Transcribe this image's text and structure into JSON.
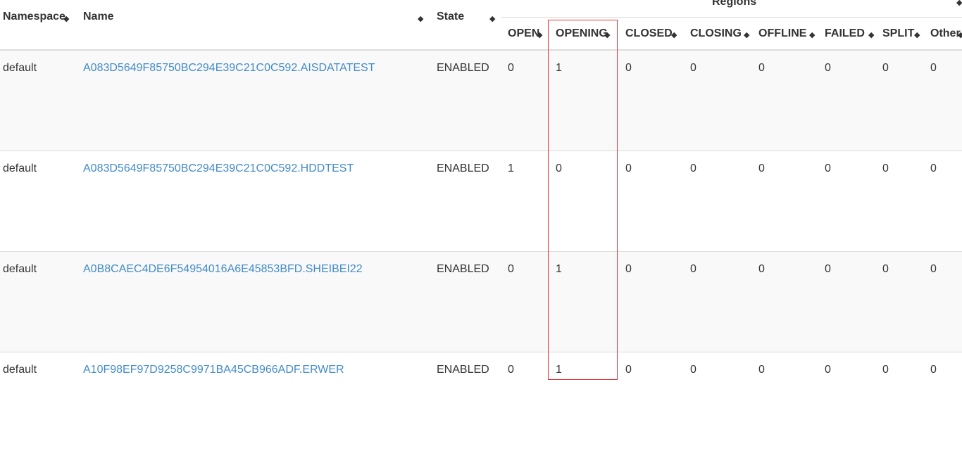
{
  "table": {
    "headers": {
      "namespace": "Namespace",
      "name": "Name",
      "state": "State",
      "regions": "Regions",
      "open": "OPEN",
      "opening": "OPENING",
      "closed": "CLOSED",
      "closing": "CLOSING",
      "offline": "OFFLINE",
      "failed": "FAILED",
      "split": "SPLIT",
      "other": "Other"
    },
    "sort_glyph": "◆",
    "rows": [
      {
        "namespace": "default",
        "name": "A083D5649F85750BC294E39C21C0C592.AISDATATEST",
        "state": "ENABLED",
        "open": "0",
        "opening": "1",
        "closed": "0",
        "closing": "0",
        "offline": "0",
        "failed": "0",
        "split": "0",
        "other": "0"
      },
      {
        "namespace": "default",
        "name": "A083D5649F85750BC294E39C21C0C592.HDDTEST",
        "state": "ENABLED",
        "open": "1",
        "opening": "0",
        "closed": "0",
        "closing": "0",
        "offline": "0",
        "failed": "0",
        "split": "0",
        "other": "0"
      },
      {
        "namespace": "default",
        "name": "A0B8CAEC4DE6F54954016A6E45853BFD.SHEIBEI22",
        "state": "ENABLED",
        "open": "0",
        "opening": "1",
        "closed": "0",
        "closing": "0",
        "offline": "0",
        "failed": "0",
        "split": "0",
        "other": "0"
      },
      {
        "namespace": "default",
        "name": "A10F98EF97D9258C9971BA45CB966ADF.ERWER",
        "state": "ENABLED",
        "open": "0",
        "opening": "1",
        "closed": "0",
        "closing": "0",
        "offline": "0",
        "failed": "0",
        "split": "0",
        "other": "0"
      }
    ]
  },
  "colors": {
    "link": "#428bca",
    "stripe": "#f9f9f9",
    "border": "#dddddd",
    "highlight": "#e8363c"
  }
}
